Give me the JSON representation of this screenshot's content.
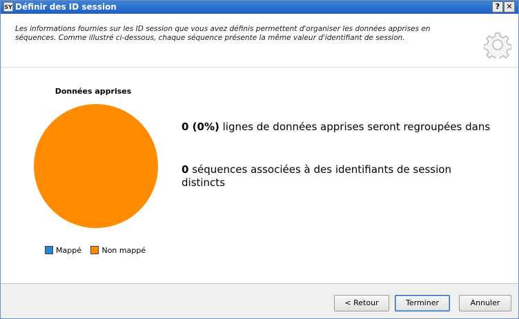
{
  "window": {
    "title": "Définir des ID session",
    "icon_label": "SY",
    "help_label": "?",
    "close_label": "✕"
  },
  "header": {
    "description": "Les informations fournies sur les ID session que vous avez définis permettent d'organiser les données apprises en séquences. Comme illustré ci-dessous, chaque séquence présente la même valeur d'identifiant de session.",
    "icon": "gear-icon"
  },
  "chart": {
    "title": "Données apprises",
    "legend": [
      {
        "label": "Mappé",
        "color": "#2b84d6"
      },
      {
        "label": "Non mappé",
        "color": "#ff8c00"
      }
    ]
  },
  "chart_data": {
    "type": "pie",
    "title": "Données apprises",
    "categories": [
      "Mappé",
      "Non mappé"
    ],
    "values": [
      0,
      100
    ],
    "colors": [
      "#2b84d6",
      "#ff8c00"
    ],
    "legend_position": "bottom"
  },
  "stats": {
    "line1_value": "0 (0%)",
    "line1_text": " lignes de données apprises seront regroupées dans",
    "line2_value": "0",
    "line2_text": " séquences associées à des identifiants de session distincts"
  },
  "buttons": {
    "back": "< Retour",
    "finish": "Terminer",
    "cancel": "Annuler"
  }
}
